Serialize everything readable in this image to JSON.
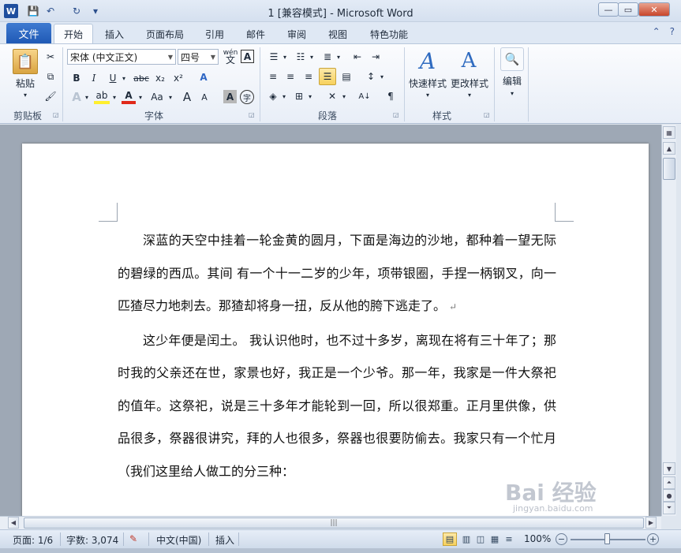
{
  "window": {
    "title": "1 [兼容模式]  -  Microsoft Word",
    "app_letter": "W",
    "controls": {
      "minimize": "—",
      "maximize": "▭",
      "close": "✕"
    }
  },
  "quick_access": {
    "save_glyph": "💾",
    "undo_glyph": "↶",
    "redo_glyph": "↻",
    "customize_glyph": "▾"
  },
  "tabs": {
    "file": "文件",
    "items": [
      "开始",
      "插入",
      "页面布局",
      "引用",
      "邮件",
      "审阅",
      "视图",
      "特色功能"
    ],
    "active": "开始"
  },
  "ribbon": {
    "clipboard": {
      "paste": "粘贴",
      "cut": "✂",
      "copy": "⧉",
      "format_painter": "🖌",
      "label": "剪贴板"
    },
    "font": {
      "font_name": "宋体 (中文正文)",
      "font_size": "四号",
      "phonetic": "wén",
      "border_char": "A",
      "bold": "B",
      "italic": "I",
      "underline": "U",
      "strike": "abc",
      "subscript": "x₂",
      "superscript": "x²",
      "clear_format": "A",
      "text_effect": "A",
      "highlight": "ab",
      "font_color": "A",
      "change_case": "Aa",
      "grow": "A",
      "shrink": "A",
      "char_shading": "A",
      "enclose": "字",
      "label": "字体"
    },
    "paragraph": {
      "label": "段落"
    },
    "styles": {
      "quick": "快速样式",
      "change": "更改样式",
      "label": "样式"
    },
    "editing": {
      "label": "编辑"
    }
  },
  "document": {
    "paragraphs": [
      "深蓝的天空中挂着一轮金黄的圆月，下面是海边的沙地，都种着一望无际的碧绿的西瓜。其间 有一个十一二岁的少年，项带银圈，手捏一柄钢叉，向一匹猹尽力地刺去。那猹却将身一扭，反从他的胯下逃走了。",
      "这少年便是闰土。 我认识他时，也不过十多岁，离现在将有三十年了；那时我的父亲还在世，家景也好，我正是一个少爷。那一年，我家是一件大祭祀的值年。这祭祀，说是三十多年才能轮到一回，所以很郑重。正月里供像，供品很多，祭器很讲究，拜的人也很多，祭器也很要防偷去。我家只有一个忙月（我们这里给人做工的分三种："
    ],
    "para_mark": "↵"
  },
  "statusbar": {
    "page": "页面: 1/6",
    "words": "字数: 3,074",
    "language": "中文(中国)",
    "mode": "插入",
    "zoom": "100%",
    "zoom_level": 1.0
  },
  "watermark": {
    "main": "Bai 经验",
    "sub": "jingyan.baidu.com"
  }
}
